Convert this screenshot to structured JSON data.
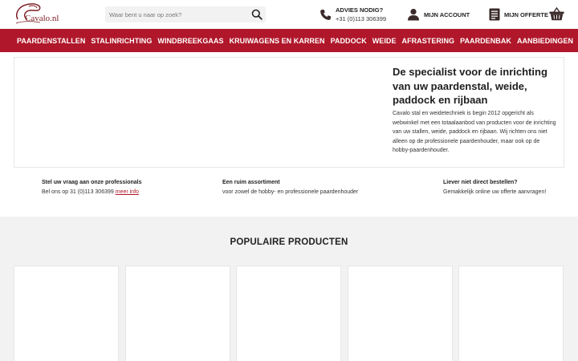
{
  "header": {
    "logo_text": "Cavalo.nl",
    "search": {
      "placeholder": "Waar bent u naar op zoek?",
      "value": ""
    },
    "advies": {
      "title": "ADVIES NODIG?",
      "phone": "+31 (0)113 306399"
    },
    "account_label": "MIJN ACCOUNT",
    "offerte_label": "MIJN OFFERTE"
  },
  "nav": {
    "items": [
      "PAARDENSTALLEN",
      "STALINRICHTING",
      "WINDBREEKGAAS",
      "KRUIWAGENS EN KARREN",
      "PADDOCK",
      "WEIDE",
      "AFRASTERING",
      "PAARDENBAK",
      "AANBIEDINGEN"
    ]
  },
  "hero": {
    "title": "De specialist voor de inrichting van uw paardenstal, weide, paddock en rijbaan",
    "text": "Cavalo stal en weidetechniek is begin 2012 opgericht als webwinkel met een totaalaanbod van producten voor de inrichting van uw stallen, weide, paddock en rijbaan. Wij richten ons niet alleen op de professionele paardenhouder, maar ook op de hobby-paardenhouder."
  },
  "usps": [
    {
      "heading": "Stel uw vraag aan onze professionals",
      "text": "Bel ons op 31 (0)113 306399",
      "link": "meer info"
    },
    {
      "heading": "Een ruim assortiment",
      "text": "voor zowel de hobby- en professionele paardenhouder"
    },
    {
      "heading": "Liever niet direct bestellen?",
      "text": "Gemakkelijk online uw offerte aanvragen!"
    }
  ],
  "products": {
    "title": "POPULAIRE PRODUCTEN",
    "cards": [
      "",
      "",
      "",
      "",
      ""
    ]
  },
  "colors": {
    "brand": "#b0172a",
    "products_bg": "#f2f2f2",
    "search_bg": "#f2f2f2"
  },
  "icons": [
    "search-icon",
    "phone-icon",
    "user-icon",
    "quote-list-icon",
    "basket-icon"
  ]
}
